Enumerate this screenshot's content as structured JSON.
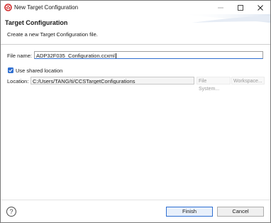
{
  "window": {
    "title": "New Target Configuration"
  },
  "header": {
    "title": "Target Configuration",
    "message": "Create a new Target Configuration file."
  },
  "form": {
    "file_name_label": "File name:",
    "file_name_value": "ADP32F035_Configuration.ccxml",
    "use_shared_label": "Use shared location",
    "use_shared_checked": true,
    "location_label": "Location:",
    "location_value": "C:/Users/TANG/ti/CCSTargetConfigurations",
    "file_system_label": "File System...",
    "workspace_label": "Workspace..."
  },
  "footer": {
    "finish_label": "Finish",
    "cancel_label": "Cancel",
    "help_glyph": "?"
  },
  "colors": {
    "accent": "#2f6fd1",
    "app_icon": "#d32f2f"
  }
}
